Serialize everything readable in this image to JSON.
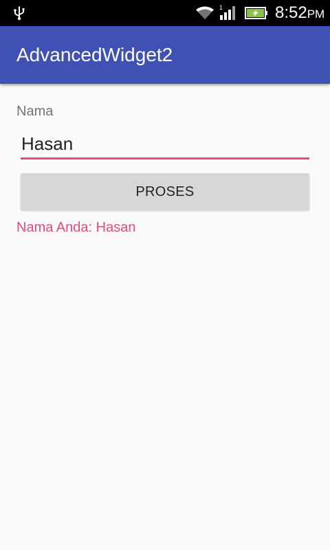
{
  "status_bar": {
    "time": "8:52",
    "ampm": "PM",
    "signal_badge": "1",
    "icons": [
      "usb-icon",
      "wifi-icon",
      "signal-icon",
      "battery-charging-icon"
    ]
  },
  "app_bar": {
    "title": "AdvancedWidget2"
  },
  "form": {
    "name_label": "Nama",
    "name_value": "Hasan",
    "button_label": "PROSES",
    "result_text": "Nama Anda: Hasan"
  },
  "colors": {
    "status_bar": "#000000",
    "app_bar": "#3f51b5",
    "background": "#fafafa",
    "accent": "#e8477f",
    "button": "#d6d7d7",
    "battery_fill": "#8bc34a"
  }
}
